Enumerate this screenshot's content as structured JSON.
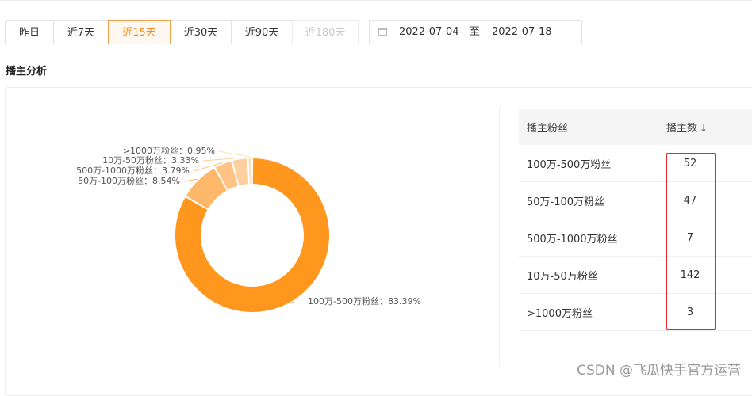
{
  "range_tabs": [
    {
      "label": "昨日",
      "state": "normal"
    },
    {
      "label": "近7天",
      "state": "normal"
    },
    {
      "label": "近15天",
      "state": "active"
    },
    {
      "label": "近30天",
      "state": "normal"
    },
    {
      "label": "近90天",
      "state": "normal"
    },
    {
      "label": "近180天",
      "state": "disabled"
    }
  ],
  "date_picker": {
    "icon": "calendar-icon",
    "start": "2022-07-04",
    "separator": "至",
    "end": "2022-07-18"
  },
  "section_title": "播主分析",
  "table": {
    "headers": {
      "fans": "播主粉丝",
      "count": "播主数",
      "sort_icon": "sort-desc-icon"
    },
    "rows": [
      {
        "fans": "100万-500万粉丝",
        "count": "52"
      },
      {
        "fans": "50万-100万粉丝",
        "count": "47"
      },
      {
        "fans": "500万-1000万粉丝",
        "count": "7"
      },
      {
        "fans": "10万-50万粉丝",
        "count": "142"
      },
      {
        "fans": ">1000万粉丝",
        "count": "3"
      }
    ]
  },
  "chart_data": {
    "type": "pie",
    "slices": [
      {
        "label": "100万-500万粉丝",
        "value": 83.39,
        "color": "#ff961e",
        "display": "100万-500万粉丝：83.39%"
      },
      {
        "label": "50万-100万粉丝",
        "value": 8.54,
        "color": "#ffb769",
        "display": "50万-100万粉丝：8.54%"
      },
      {
        "label": "500万-1000万粉丝",
        "value": 3.79,
        "color": "#ffc385",
        "display": "500万-1000万粉丝：3.79%"
      },
      {
        "label": "10万-50万粉丝",
        "value": 3.33,
        "color": "#ffcf9f",
        "display": "10万-50万粉丝：3.33%"
      },
      {
        "label": ">1000万粉丝",
        "value": 0.95,
        "color": "#ffdfbd",
        "display": ">1000万粉丝：0.95%"
      }
    ]
  },
  "colors": {
    "accent": "#f08c23",
    "highlight_box": "#e8262b"
  },
  "watermark": "CSDN @飞瓜快手官方运营"
}
